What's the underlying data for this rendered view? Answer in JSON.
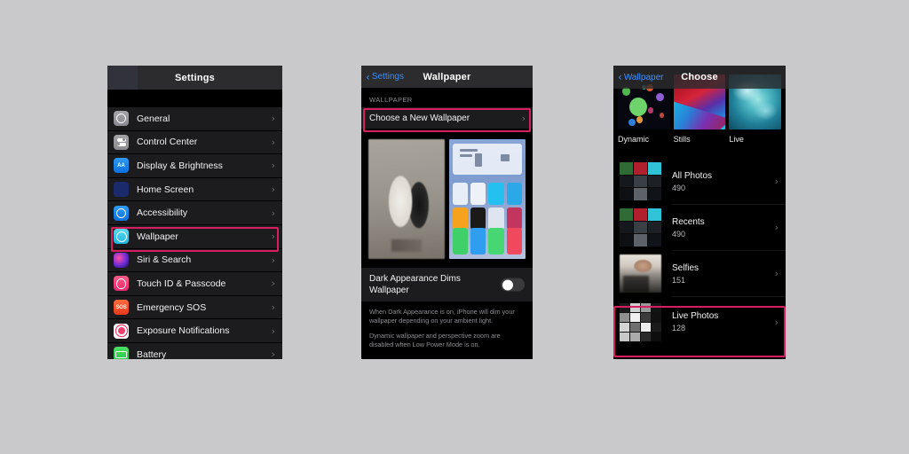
{
  "background_color": "#c9c9cc",
  "highlight_color": "#d81e60",
  "panels": {
    "settings": {
      "nav_title": "Settings",
      "rows": [
        {
          "label": "General",
          "icon": "gear-icon"
        },
        {
          "label": "Control Center",
          "icon": "control-center-icon"
        },
        {
          "label": "Display & Brightness",
          "icon": "display-brightness-icon"
        },
        {
          "label": "Home Screen",
          "icon": "home-screen-icon"
        },
        {
          "label": "Accessibility",
          "icon": "accessibility-icon"
        },
        {
          "label": "Wallpaper",
          "icon": "wallpaper-icon"
        },
        {
          "label": "Siri & Search",
          "icon": "siri-icon"
        },
        {
          "label": "Touch ID & Passcode",
          "icon": "touch-id-icon"
        },
        {
          "label": "Emergency SOS",
          "icon": "sos-icon"
        },
        {
          "label": "Exposure Notifications",
          "icon": "exposure-notifications-icon"
        },
        {
          "label": "Battery",
          "icon": "battery-icon"
        }
      ],
      "chevron": "›",
      "highlighted_row": "Wallpaper"
    },
    "wallpaper": {
      "back_label": "Settings",
      "back_chevron": "‹",
      "nav_title": "Wallpaper",
      "section_header": "WALLPAPER",
      "choose_row_label": "Choose a New Wallpaper",
      "chevron": "›",
      "toggle_label": "Dark Appearance Dims Wallpaper",
      "toggle_state": "off",
      "footer_paragraphs": [
        "When Dark Appearance is on, iPhone will dim your wallpaper depending on your ambient light.",
        "Dynamic wallpaper and perspective zoom are disabled when Low Power Mode is on."
      ]
    },
    "choose": {
      "back_label": "Wallpaper",
      "back_chevron": "‹",
      "nav_title": "Choose",
      "categories": [
        {
          "label": "Dynamic"
        },
        {
          "label": "Stills"
        },
        {
          "label": "Live"
        }
      ],
      "albums": [
        {
          "title": "All Photos",
          "count": "490"
        },
        {
          "title": "Recents",
          "count": "490"
        },
        {
          "title": "Selfies",
          "count": "151"
        },
        {
          "title": "Live Photos",
          "count": "128"
        }
      ],
      "chevron": "›",
      "highlighted_album": "Live Photos"
    }
  }
}
